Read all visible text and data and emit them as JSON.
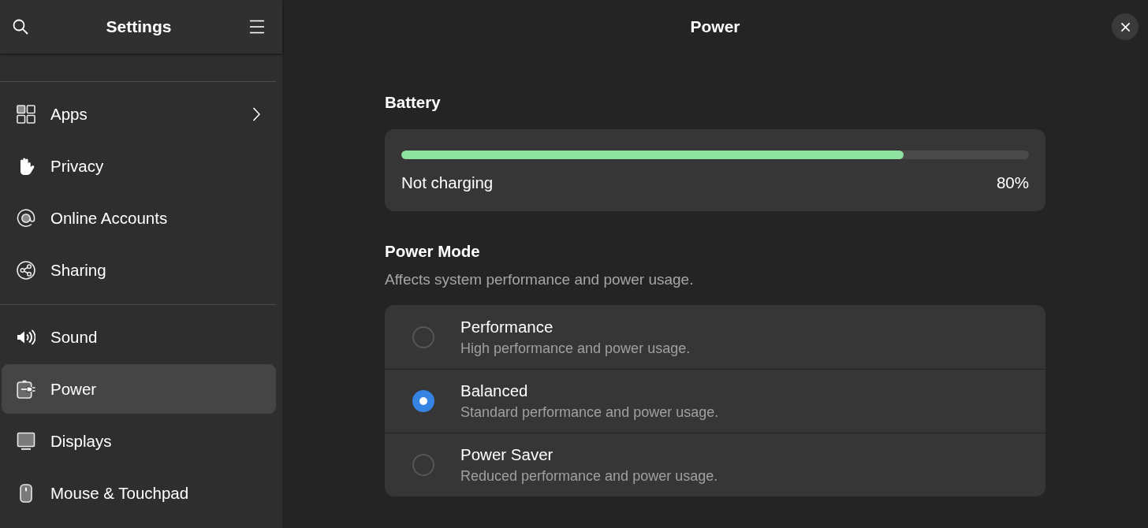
{
  "sidebar": {
    "title": "Settings",
    "sections": [
      {
        "items": [
          {
            "label": "Apps",
            "selected": false,
            "chevron": true
          },
          {
            "label": "Privacy",
            "selected": false,
            "chevron": false
          },
          {
            "label": "Online Accounts",
            "selected": false,
            "chevron": false
          },
          {
            "label": "Sharing",
            "selected": false,
            "chevron": false
          }
        ]
      },
      {
        "items": [
          {
            "label": "Sound",
            "selected": false,
            "chevron": false
          },
          {
            "label": "Power",
            "selected": true,
            "chevron": false
          },
          {
            "label": "Displays",
            "selected": false,
            "chevron": false
          },
          {
            "label": "Mouse & Touchpad",
            "selected": false,
            "chevron": false
          }
        ]
      }
    ]
  },
  "main": {
    "title": "Power"
  },
  "battery": {
    "heading": "Battery",
    "level": 0.8,
    "status": "Not charging",
    "percent": "80%"
  },
  "power_mode": {
    "heading": "Power Mode",
    "description": "Affects system performance and power usage.",
    "options": [
      {
        "title": "Performance",
        "description": "High performance and power usage.",
        "selected": false
      },
      {
        "title": "Balanced",
        "description": "Standard performance and power usage.",
        "selected": true
      },
      {
        "title": "Power Saver",
        "description": "Reduced performance and power usage.",
        "selected": false
      }
    ]
  }
}
